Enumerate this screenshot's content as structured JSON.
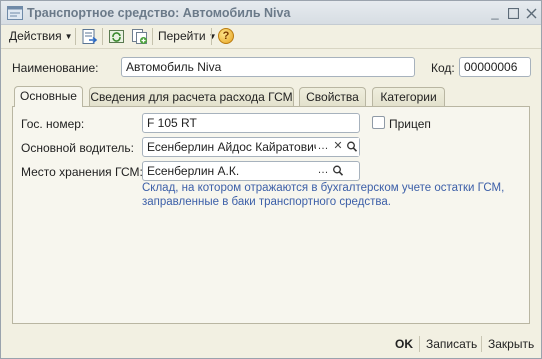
{
  "window": {
    "title": "Транспортное средство: Автомобиль Niva",
    "controls": [
      "minimize",
      "maximize",
      "close"
    ]
  },
  "toolbar": {
    "actions_label": "Действия",
    "goto_label": "Перейти",
    "icons": [
      "save-close-icon",
      "refresh-icon",
      "copy-icon",
      "help-icon"
    ],
    "help_glyph": "?"
  },
  "form": {
    "name_label": "Наименование:",
    "name_value": "Автомобиль Niva",
    "code_label": "Код:",
    "code_value": "00000006"
  },
  "tabs": [
    {
      "label": "Основные",
      "active": true
    },
    {
      "label": "Сведения для расчета расхода ГСМ",
      "active": false
    },
    {
      "label": "Свойства",
      "active": false
    },
    {
      "label": "Категории",
      "active": false
    }
  ],
  "main": {
    "plate_label": "Гос. номер:",
    "plate_value": "F 105 RT",
    "trailer_label": "Прицеп",
    "trailer_checked": false,
    "driver_label": "Основной водитель:",
    "driver_value": "Есенберлин Айдос Кайратович",
    "storage_label": "Место хранения ГСМ:",
    "storage_value": "Есенберлин А.К.",
    "storage_hint_line1": "Склад, на котором отражаются в бухгалтерском учете остатки ГСМ,",
    "storage_hint_line2": "заправленные в баки транспортного средства."
  },
  "footer": {
    "ok_label": "OK",
    "save_label": "Записать",
    "close_label": "Закрыть"
  },
  "colors": {
    "window_bg": "#f2f0e2",
    "panel_bg": "#f7f6ee",
    "title_text": "#6b7a89",
    "hint_text": "#3c5fa8"
  }
}
